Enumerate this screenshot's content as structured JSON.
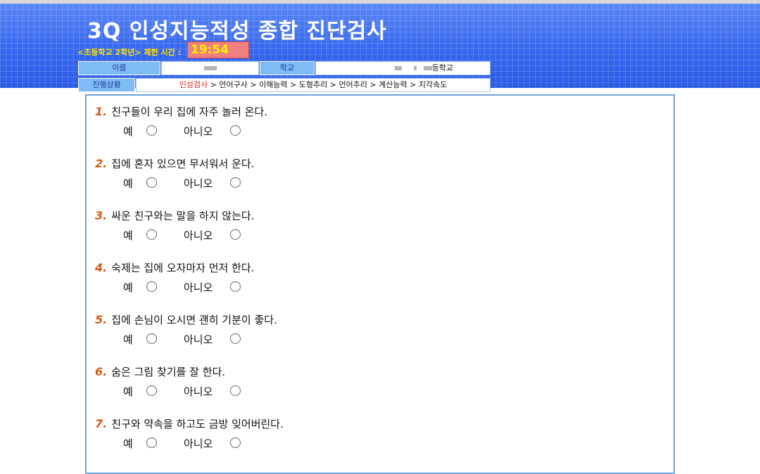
{
  "header": {
    "title": "3Q 인성지능적성 종합 진단검사",
    "grade_label": "<초등학교 2학년> 제한 시간 :",
    "timer": "19:54"
  },
  "info": {
    "name_label": "이름",
    "school_label": "학교",
    "school_value_suffix": "등학교",
    "progress_label": "진행상황"
  },
  "progress": {
    "active": "인성검사",
    "rest": " > 언어구사 > 이해능력 > 도형추리 > 언어추리 > 계산능력 > 지각속도"
  },
  "option_labels": {
    "yes": "예",
    "no": "아니오"
  },
  "questions": [
    {
      "num": "1.",
      "text": "친구들이 우리 집에 자주 놀러 온다."
    },
    {
      "num": "2.",
      "text": "집에 혼자 있으면 무서워서 운다."
    },
    {
      "num": "3.",
      "text": "싸운 친구와는 말을 하지 않는다."
    },
    {
      "num": "4.",
      "text": "숙제는 집에 오자마자 먼저 한다."
    },
    {
      "num": "5.",
      "text": "집에 손님이 오시면 괜히 기분이 좋다."
    },
    {
      "num": "6.",
      "text": "숨은 그림 찾기를 잘 한다."
    },
    {
      "num": "7.",
      "text": "친구와 약속을 하고도 금방 잊어버린다."
    }
  ]
}
